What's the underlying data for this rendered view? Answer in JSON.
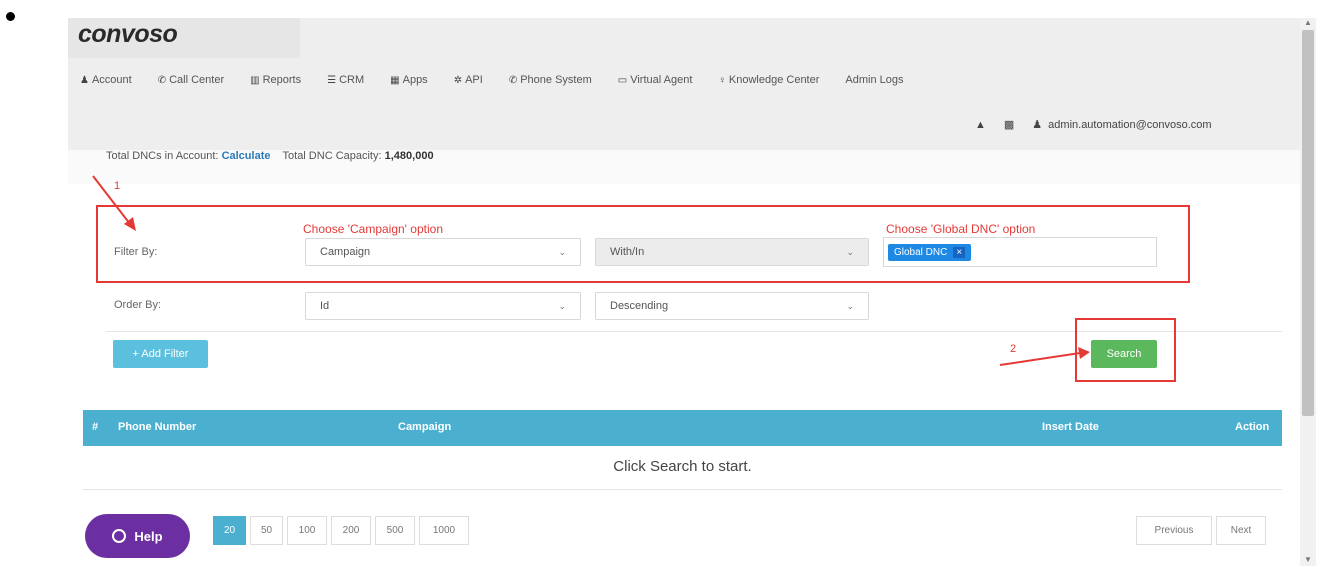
{
  "brand": {
    "logo": "convoso"
  },
  "nav": [
    {
      "icon": "user-icon",
      "glyph": "♟",
      "label": "Account"
    },
    {
      "icon": "phone-icon",
      "glyph": "✆",
      "label": "Call Center"
    },
    {
      "icon": "bar-chart-icon",
      "glyph": "▥",
      "label": "Reports"
    },
    {
      "icon": "list-icon",
      "glyph": "☰",
      "label": "CRM"
    },
    {
      "icon": "grid-icon",
      "glyph": "▦",
      "label": "Apps"
    },
    {
      "icon": "gear-icon",
      "glyph": "✲",
      "label": "API"
    },
    {
      "icon": "phone-icon",
      "glyph": "✆",
      "label": "Phone System"
    },
    {
      "icon": "monitor-icon",
      "glyph": "▭",
      "label": "Virtual Agent"
    },
    {
      "icon": "lightbulb-icon",
      "glyph": "♀",
      "label": "Knowledge Center"
    },
    {
      "icon": "",
      "glyph": "",
      "label": "Admin Logs"
    }
  ],
  "user": {
    "email": "admin.automation@convoso.com"
  },
  "stats": {
    "total_label": "Total DNCs in Account:",
    "calculate": "Calculate",
    "capacity_label": "Total DNC Capacity:",
    "capacity_value": "1,480,000"
  },
  "annotations": {
    "step1": "1",
    "step2": "2",
    "campaign_hint": "Choose 'Campaign' option",
    "global_hint": "Choose 'Global DNC' option"
  },
  "filter": {
    "label": "Filter By:",
    "field": "Campaign",
    "operator": "With/In",
    "tag": "Global DNC",
    "tag_remove": "×"
  },
  "order": {
    "label": "Order By:",
    "field": "Id",
    "direction": "Descending"
  },
  "buttons": {
    "add_filter": "+ Add Filter",
    "search": "Search"
  },
  "table": {
    "columns": [
      "#",
      "Phone Number",
      "Campaign",
      "Insert Date",
      "Action"
    ],
    "empty_message": "Click Search to start."
  },
  "pagination": {
    "sizes": [
      "20",
      "50",
      "100",
      "200",
      "500",
      "1000"
    ],
    "active_size": "20",
    "previous": "Previous",
    "next": "Next"
  },
  "help": {
    "label": "Help"
  },
  "colors": {
    "header_bg": "#eeeeee",
    "table_header": "#4bb0d0",
    "search_button": "#5cb85c",
    "add_filter_button": "#5bc0de",
    "annotation_red": "#e53935",
    "help_button": "#6b2fa2"
  }
}
